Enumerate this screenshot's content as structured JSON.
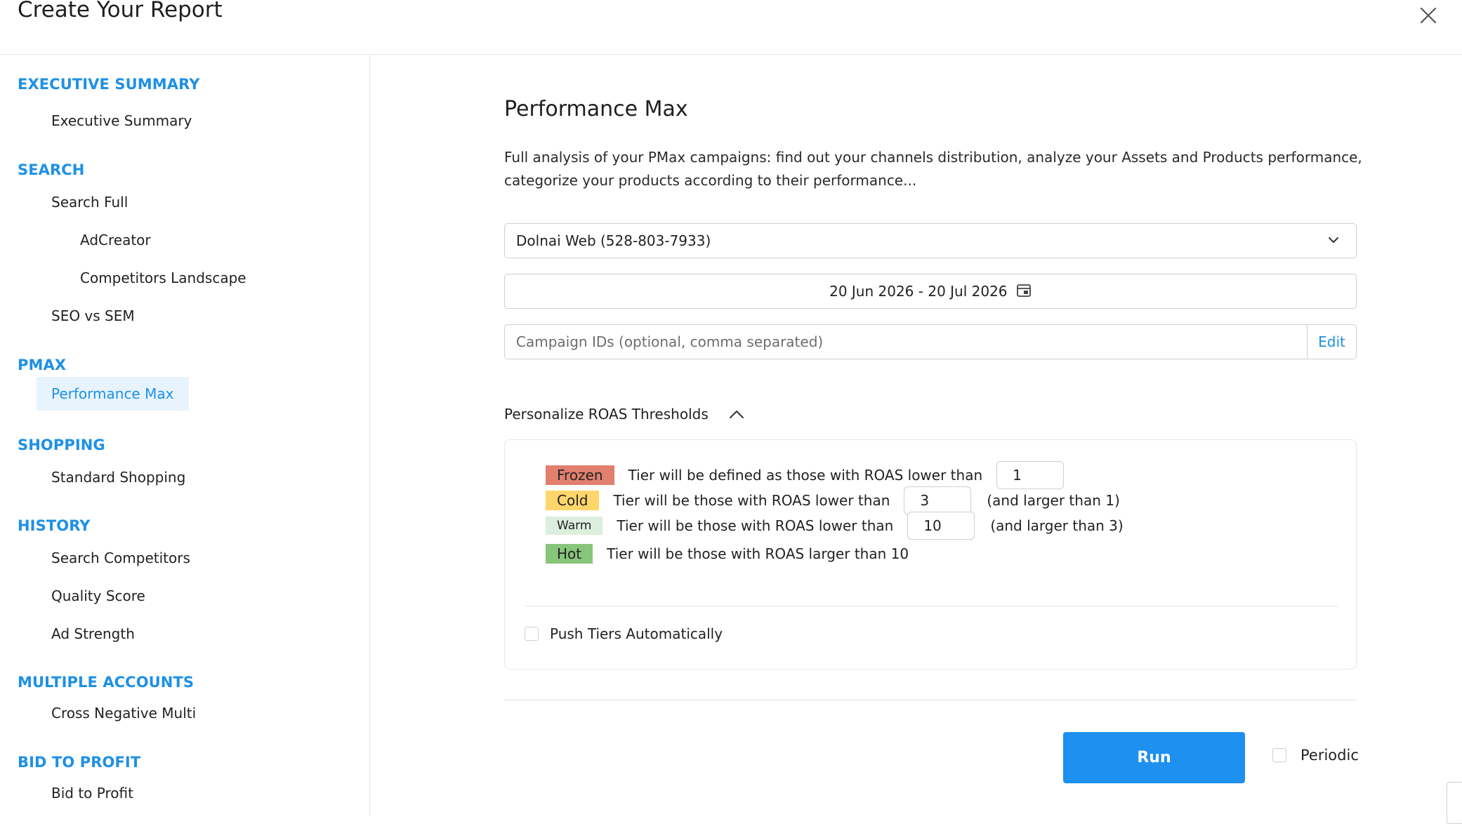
{
  "header": {
    "title": "Create Your Report"
  },
  "sidebar": {
    "sections": [
      {
        "title": "EXECUTIVE SUMMARY",
        "items": [
          {
            "label": "Executive Summary"
          }
        ]
      },
      {
        "title": "SEARCH",
        "items": [
          {
            "label": "Search Full"
          },
          {
            "label": "AdCreator"
          },
          {
            "label": "Competitors Landscape"
          },
          {
            "label": "SEO vs SEM"
          }
        ]
      },
      {
        "title": "PMAX",
        "items": [
          {
            "label": "Performance Max",
            "active": true
          }
        ]
      },
      {
        "title": "SHOPPING",
        "items": [
          {
            "label": "Standard Shopping"
          }
        ]
      },
      {
        "title": "HISTORY",
        "items": [
          {
            "label": "Search Competitors"
          },
          {
            "label": "Quality Score"
          },
          {
            "label": "Ad Strength"
          }
        ]
      },
      {
        "title": "MULTIPLE ACCOUNTS",
        "items": [
          {
            "label": "Cross Negative Multi"
          }
        ]
      },
      {
        "title": "BID TO PROFIT",
        "items": [
          {
            "label": "Bid to Profit"
          }
        ]
      }
    ]
  },
  "main": {
    "title": "Performance Max",
    "description": "Full analysis of your PMax campaigns: find out your channels distribution, analyze your Assets and Products performance, categorize your products according to their performance...",
    "account_select": {
      "value": "Dolnai Web (528-803-7933)"
    },
    "date_range": {
      "value": "20 Jun 2026 - 20 Jul 2026"
    },
    "campaign_ids": {
      "placeholder": "Campaign IDs (optional, comma separated)",
      "value": "",
      "edit_label": "Edit"
    },
    "roas": {
      "toggle_label": "Personalize ROAS Thresholds",
      "tiers": [
        {
          "badge": "Frozen",
          "text": "Tier will be defined as those with ROAS lower than",
          "input": "1",
          "suffix": ""
        },
        {
          "badge": "Cold",
          "text": "Tier will be those with ROAS lower than",
          "input": "3",
          "suffix": "(and larger than 1)"
        },
        {
          "badge": "Warm",
          "text": "Tier will be those with ROAS lower than",
          "input": "10",
          "suffix": "(and larger than 3)"
        },
        {
          "badge": "Hot",
          "text": "Tier will be those with ROAS larger than 10"
        }
      ],
      "push_label": "Push Tiers Automatically"
    },
    "run_label": "Run",
    "periodic_label": "Periodic"
  },
  "colors": {
    "accent": "#1e90e6",
    "run_button": "#1e90f0",
    "frozen": "#e27f6e",
    "cold": "#ffd66b",
    "warm": "#dceedd",
    "hot": "#87c57a",
    "active_nav_bg": "#e7f3fd"
  },
  "icons": {
    "close": "close-icon",
    "dropdown": "chevron-down-icon",
    "calendar": "calendar-icon",
    "collapse": "chevron-up-icon"
  }
}
